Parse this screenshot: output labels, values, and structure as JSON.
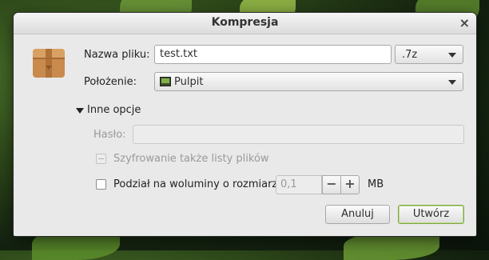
{
  "dialog": {
    "title": "Kompresja",
    "close_glyph": "×"
  },
  "form": {
    "filename_label": "Nazwa pliku:",
    "filename_value": "test.txt",
    "format_value": ".7z",
    "location_label": "Położenie:",
    "location_value": "Pulpit",
    "location_icon": "folder-desktop-icon",
    "other_options_label": "Inne opcje",
    "password_label": "Hasło:",
    "password_value": "",
    "encrypt_list_label": "Szyfrowanie także listy plików",
    "split_label": "Podział na woluminy o rozmiarze",
    "split_value": "0,1",
    "split_unit": "MB",
    "minus_glyph": "−",
    "plus_glyph": "+"
  },
  "buttons": {
    "cancel_label": "Anuluj",
    "create_label": "Utwórz"
  },
  "colors": {
    "accent_default_border": "#7fa840",
    "window_bg": "#e9e9e9"
  }
}
